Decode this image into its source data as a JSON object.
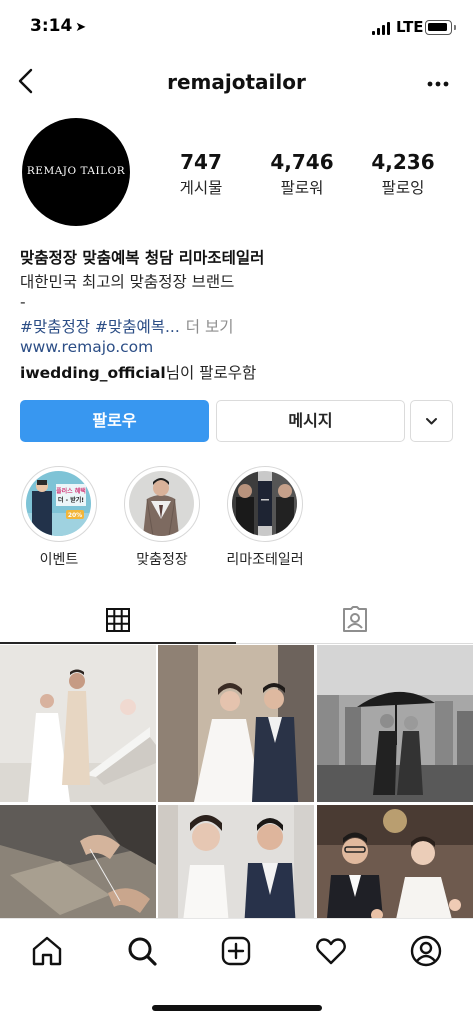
{
  "status_bar": {
    "time": "3:14",
    "network": "LTE",
    "battery_level": 0.85
  },
  "header": {
    "username": "remajotailor"
  },
  "profile": {
    "avatar_logo": "REMAJO TAILOR",
    "stats": [
      {
        "count": "747",
        "label": "게시물"
      },
      {
        "count": "4,746",
        "label": "팔로워"
      },
      {
        "count": "4,236",
        "label": "팔로잉"
      }
    ]
  },
  "bio": {
    "name": "맞춤정장 맞춤예복 청담 리마조테일러",
    "line1": "대한민국 최고의 맞춤정장 브랜드",
    "dash": "-",
    "hashtags": "#맞춤정장 #맞춤예복...",
    "more": "더 보기",
    "url": "www.remajo.com",
    "followed_by_user": "iwedding_official",
    "followed_by_suffix": "님이 팔로우함"
  },
  "actions": {
    "follow": "팔로우",
    "message": "메시지"
  },
  "highlights": [
    {
      "label": "이벤트",
      "promo_text": "플러스 혜택 더 - 받기!",
      "badge": "20%"
    },
    {
      "label": "맞춤정장"
    },
    {
      "label": "리마조테일러"
    }
  ],
  "tabs": [
    "grid",
    "tagged"
  ],
  "colors": {
    "primary": "#3897f0",
    "link": "#2c4e86",
    "text": "#262626",
    "muted": "#8e8e8e",
    "border": "#dbdbdb"
  },
  "bottom_nav": [
    "home-icon",
    "search-icon",
    "new-post-icon",
    "activity-heart-icon",
    "profile-icon"
  ]
}
